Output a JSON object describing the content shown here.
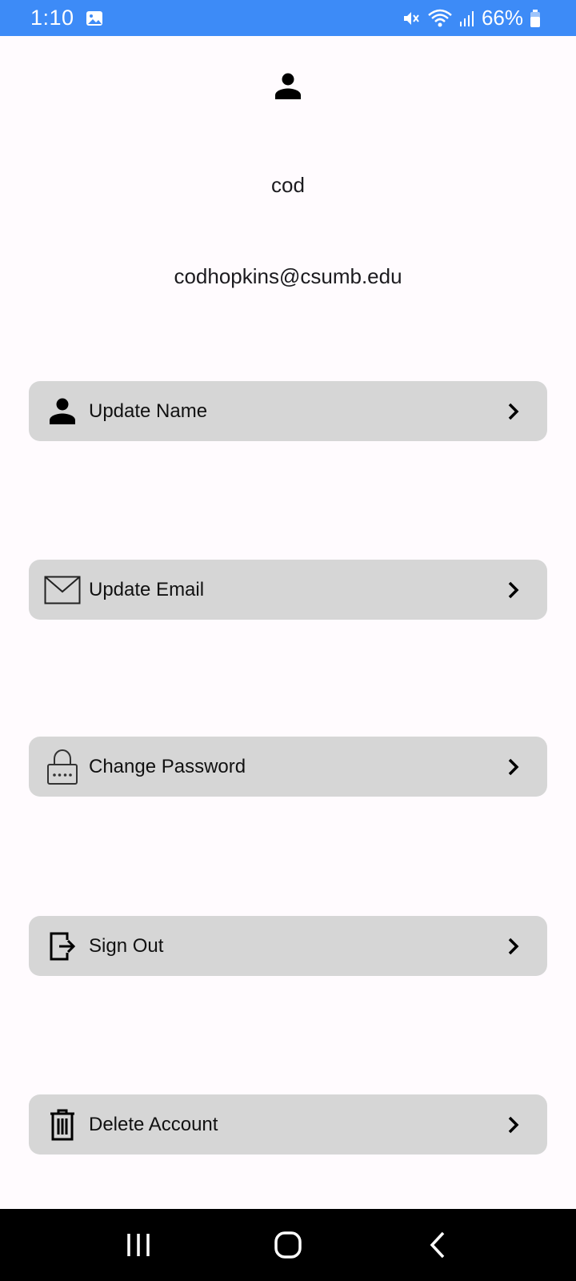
{
  "status_bar": {
    "time": "1:10",
    "battery": "66%",
    "icons": [
      "image-icon",
      "mute-icon",
      "wifi-icon",
      "signal-icon",
      "battery-icon"
    ],
    "background": "#3d8bf7"
  },
  "profile": {
    "icon": "person-icon",
    "name": "cod",
    "email": "codhopkins@csumb.edu"
  },
  "menu": {
    "items": [
      {
        "label": "Update Name",
        "icon": "person-icon"
      },
      {
        "label": "Update Email",
        "icon": "envelope-icon"
      },
      {
        "label": "Change Password",
        "icon": "lock-icon"
      },
      {
        "label": "Sign Out",
        "icon": "sign-out-icon"
      },
      {
        "label": "Delete Account",
        "icon": "trash-icon"
      }
    ],
    "button_color": "#d6d6d6"
  },
  "nav_bar": {
    "buttons": [
      "recent-apps-icon",
      "home-icon",
      "back-icon"
    ]
  }
}
